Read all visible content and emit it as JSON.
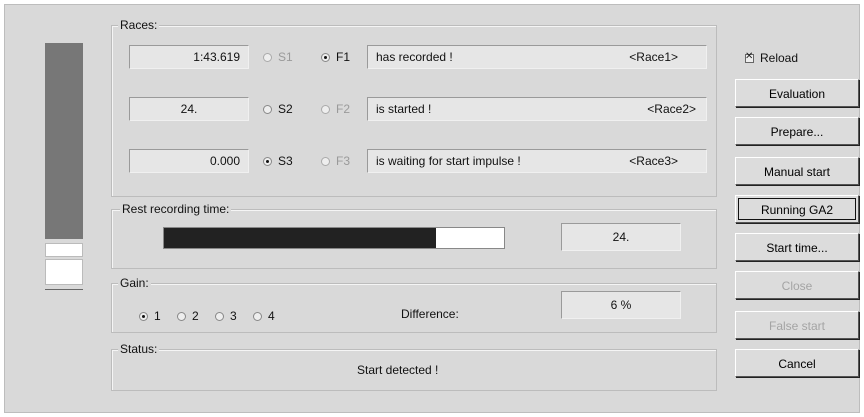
{
  "races": {
    "title": "Races:",
    "rows": [
      {
        "value": "1:43.619",
        "s_label": "S1",
        "s_selected": false,
        "s_enabled": false,
        "f_label": "F1",
        "f_selected": true,
        "f_enabled": true,
        "status": "has recorded !",
        "race": "<Race1>"
      },
      {
        "value": "24.",
        "s_label": "S2",
        "s_selected": false,
        "s_enabled": true,
        "f_label": "F2",
        "f_selected": false,
        "f_enabled": false,
        "status": "is started !",
        "race": "<Race2>"
      },
      {
        "value": "0.000",
        "s_label": "S3",
        "s_selected": true,
        "s_enabled": true,
        "f_label": "F3",
        "f_selected": false,
        "f_enabled": false,
        "status": "is waiting for start impulse !",
        "race": "<Race3>"
      }
    ]
  },
  "recording": {
    "title": "Rest recording time:",
    "progress_fraction": 0.8,
    "value": "24."
  },
  "gain": {
    "title": "Gain:",
    "options": [
      {
        "label": "1",
        "selected": true
      },
      {
        "label": "2",
        "selected": false
      },
      {
        "label": "3",
        "selected": false
      },
      {
        "label": "4",
        "selected": false
      }
    ],
    "difference_label": "Difference:",
    "difference_value": "6 %"
  },
  "status": {
    "title": "Status:",
    "text": "Start detected !"
  },
  "reload_label": "Reload",
  "buttons": {
    "evaluation": "Evaluation",
    "prepare": "Prepare...",
    "manual_start": "Manual start",
    "running": "Running GA2",
    "start_time": "Start time...",
    "close": "Close",
    "false_start": "False start",
    "cancel": "Cancel"
  }
}
